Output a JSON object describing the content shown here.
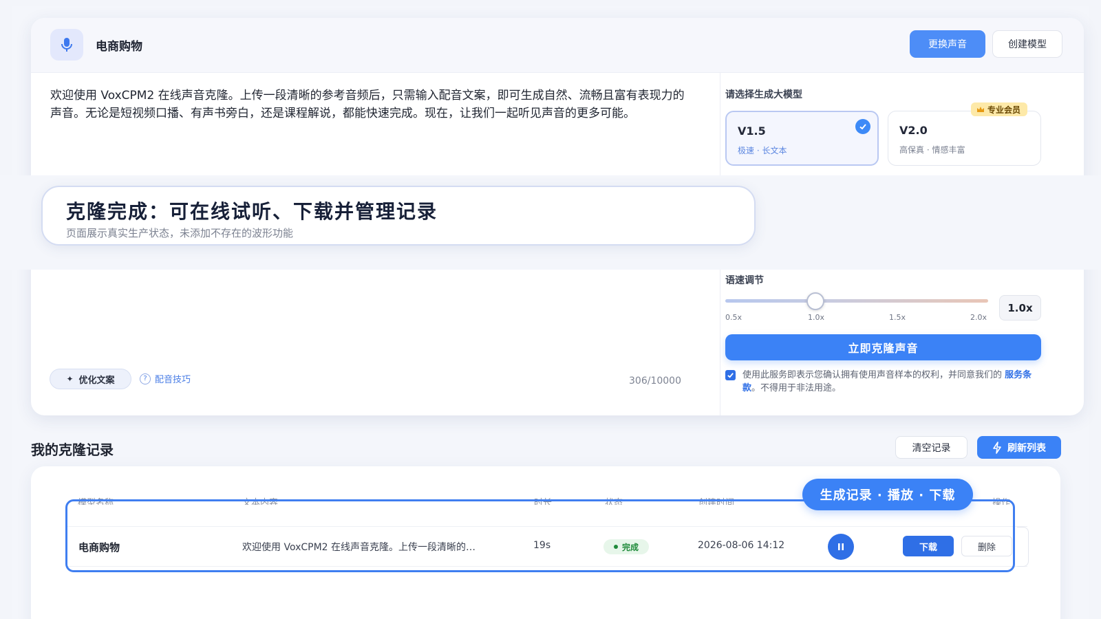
{
  "header": {
    "title": "电商购物",
    "change_voice_label": "更换声音",
    "create_model_label": "创建模型"
  },
  "editor": {
    "text": "欢迎使用 VoxCPM2 在线声音克隆。上传一段清晰的参考音频后，只需输入配音文案，即可生成自然、流畅且富有表现力的声音。无论是短视频口播、有声书旁白，还是课程解说，都能快速完成。现在，让我们一起听见声音的更多可能。",
    "optimize_label": "优化文案",
    "tips_label": "配音技巧",
    "char_count": "306/10000"
  },
  "model_select": {
    "label": "请选择生成大模型",
    "models": [
      {
        "name": "V1.5",
        "desc": "极速 · 长文本",
        "selected": true
      },
      {
        "name": "V2.0",
        "desc": "高保真 · 情感丰富",
        "selected": false,
        "badge": "专业会员"
      }
    ]
  },
  "banner": {
    "title": "克隆完成：可在线试听、下载并管理记录",
    "subtitle": "页面展示真实生产状态，未添加不存在的波形功能"
  },
  "speed": {
    "label": "语速调节",
    "ticks": [
      "0.5x",
      "1.0x",
      "1.5x",
      "2.0x"
    ],
    "value": "1.0x",
    "value_number": 1.0,
    "min": 0.5,
    "max": 2.0
  },
  "clone": {
    "button_label": "立即克隆声音",
    "consent_before": "使用此服务即表示您确认拥有使用声音样本的权利，并同意我们的 ",
    "consent_link": "服务条款",
    "consent_after": "。不得用于非法用途。",
    "consent_checked": true
  },
  "records": {
    "title": "我的克隆记录",
    "clear_label": "清空记录",
    "refresh_label": "刷新列表",
    "columns": [
      "模型名称",
      "文本内容",
      "时长",
      "状态",
      "创建时间",
      "操作"
    ],
    "rows": [
      {
        "model": "电商购物",
        "text": "欢迎使用 VoxCPM2 在线声音克隆。上传一段清晰的…",
        "duration": "19s",
        "status": "完成",
        "created": "2026-08-06 14:12",
        "download_label": "下载",
        "delete_label": "删除"
      }
    ],
    "callout": "生成记录 · 播放 · 下载"
  },
  "colors": {
    "accent": "#3b82f6",
    "status_ok": "#1f8a3a",
    "vip": "#fde9a8"
  },
  "icons": [
    "microphone-icon",
    "check-icon",
    "crown-icon",
    "sparkle-icon",
    "question-icon",
    "lightning-icon",
    "pause-icon"
  ]
}
